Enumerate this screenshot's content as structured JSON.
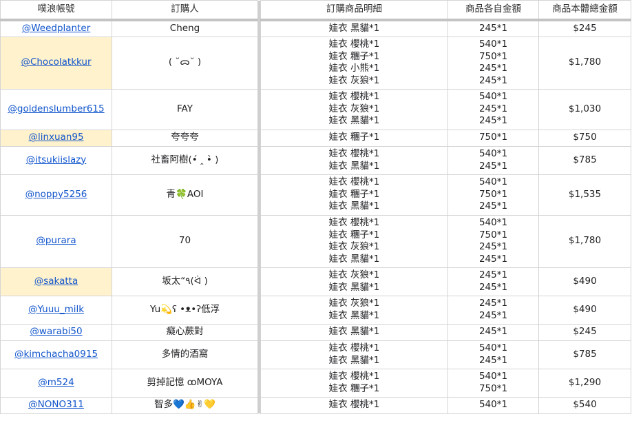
{
  "headers": [
    "噗浪帳號",
    "訂購人",
    "訂購商品明細",
    "商品各自金額",
    "商品本體總金額"
  ],
  "rows": [
    {
      "plurk": "@Weedplanter",
      "hl": false,
      "buyer": "Cheng",
      "items": [
        "娃衣 黑貓*1"
      ],
      "prices": [
        "245*1"
      ],
      "total": "$245"
    },
    {
      "plurk": "@Chocolatkkur",
      "hl": true,
      "buyer": "( ˘ᯅ˘ )",
      "items": [
        "娃衣 櫻桃*1",
        "娃衣 糰子*1",
        "娃衣 小熊*1",
        "娃衣 灰狼*1"
      ],
      "prices": [
        "540*1",
        "750*1",
        "245*1",
        "245*1"
      ],
      "total": "$1,780"
    },
    {
      "plurk": "@goldenslumber615",
      "hl": false,
      "buyer": "FAY",
      "items": [
        "娃衣 櫻桃*1",
        "娃衣 灰狼*1",
        "娃衣 黑貓*1"
      ],
      "prices": [
        "540*1",
        "245*1",
        "245*1"
      ],
      "total": "$1,030"
    },
    {
      "plurk": "@linxuan95",
      "hl": true,
      "buyer": "夸夸夸",
      "items": [
        "娃衣 糰子*1"
      ],
      "prices": [
        "750*1"
      ],
      "total": "$750"
    },
    {
      "plurk": "@itsukiislazy",
      "hl": false,
      "buyer": "社畜阿樹(•́ ‸ •̀ )",
      "items": [
        "娃衣 櫻桃*1",
        "娃衣 黑貓*1"
      ],
      "prices": [
        "540*1",
        "245*1"
      ],
      "total": "$785"
    },
    {
      "plurk": "@noppy5256",
      "hl": false,
      "buyer": "青🍀AOI",
      "items": [
        "娃衣 櫻桃*1",
        "娃衣 糰子*1",
        "娃衣 黑貓*1"
      ],
      "prices": [
        "540*1",
        "750*1",
        "245*1"
      ],
      "total": "$1,535"
    },
    {
      "plurk": "@purara",
      "hl": false,
      "buyer": "70",
      "items": [
        "娃衣 櫻桃*1",
        "娃衣 糰子*1",
        "娃衣 灰狼*1",
        "娃衣 黑貓*1"
      ],
      "prices": [
        "540*1",
        "750*1",
        "245*1",
        "245*1"
      ],
      "total": "$1,780"
    },
    {
      "plurk": "@sakatta",
      "hl": true,
      "buyer": "坂太“٩(ᐛ )",
      "items": [
        "娃衣 灰狼*1",
        "娃衣 黑貓*1"
      ],
      "prices": [
        "245*1",
        "245*1"
      ],
      "total": "$490"
    },
    {
      "plurk": "@Yuuu_milk",
      "hl": false,
      "buyer": "Yu💫ʕ •ᴥ•ʔ低浮",
      "items": [
        "娃衣 灰狼*1",
        "娃衣 黑貓*1"
      ],
      "prices": [
        "245*1",
        "245*1"
      ],
      "total": "$490"
    },
    {
      "plurk": "@warabi50",
      "hl": false,
      "buyer": "癡心蕨對",
      "items": [
        "娃衣 黑貓*1"
      ],
      "prices": [
        "245*1"
      ],
      "total": "$245"
    },
    {
      "plurk": "@kimchacha0915",
      "hl": false,
      "buyer": "多情的酒窩",
      "items": [
        "娃衣 櫻桃*1",
        "娃衣 黑貓*1"
      ],
      "prices": [
        "540*1",
        "245*1"
      ],
      "total": "$785"
    },
    {
      "plurk": "@m524",
      "hl": false,
      "buyer": "剪掉記憶 ꝏMOYA",
      "items": [
        "娃衣 櫻桃*1",
        "娃衣 糰子*1"
      ],
      "prices": [
        "540*1",
        "750*1"
      ],
      "total": "$1,290"
    },
    {
      "plurk": "@NONO311",
      "hl": false,
      "buyer": "智多💙👍✌💛",
      "items": [
        "娃衣 櫻桃*1"
      ],
      "prices": [
        "540*1"
      ],
      "total": "$540"
    }
  ]
}
